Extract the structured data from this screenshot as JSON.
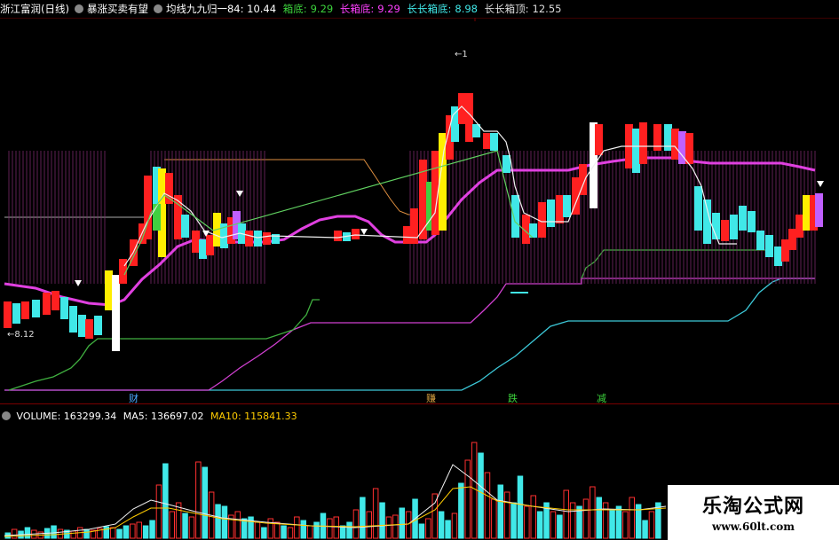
{
  "header": {
    "title": "浙江富润(日线)",
    "indicator": "暴涨买卖有望",
    "ma_label": "均线九九归一84: 10.44",
    "box_bottom_label": "箱底:",
    "box_bottom_value": "9.29",
    "long_box_bottom_label": "长箱底:",
    "long_box_bottom_value": "9.29",
    "long_long_bottom_label": "长长箱底:",
    "long_long_bottom_value": "8.98",
    "long_long_top_label": "长长箱顶:",
    "long_long_top_value": "12.55"
  },
  "volume_header": {
    "volume": "VOLUME: 163299.34",
    "ma5": "MA5: 136697.02",
    "ma10": "MA10: 115841.33"
  },
  "annotations": {
    "low_label": "←8.12",
    "high_label": "←1"
  },
  "markers": [
    {
      "text": "财",
      "color": "#4aa8ff"
    },
    {
      "text": "赚",
      "color": "#d8a040"
    },
    {
      "text": "跌",
      "color": "#3cd23c"
    },
    {
      "text": "减",
      "color": "#3cd23c"
    }
  ],
  "watermark": {
    "title": "乐淘公式网",
    "url": "www.60lt.com"
  },
  "colors": {
    "up": "#ff2020",
    "down": "#40e8e8",
    "ma_line": "#e040e0",
    "label_green": "#3cd23c",
    "label_magenta": "#ff40ff",
    "label_cyan": "#40e8e8",
    "vol_ma10": "#ffcc00"
  }
}
